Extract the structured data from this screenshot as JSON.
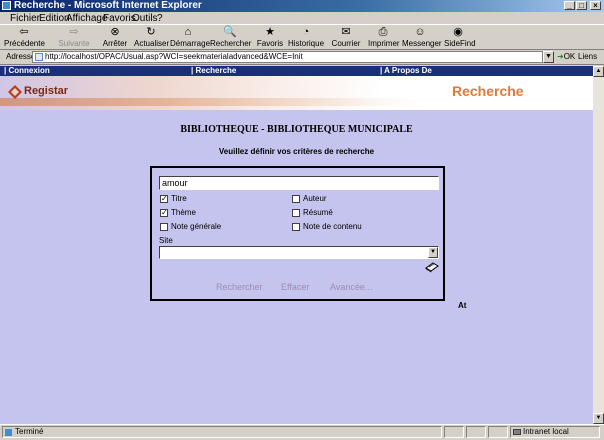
{
  "window": {
    "title": "Recherche - Microsoft Internet Explorer"
  },
  "menu": [
    "Fichier",
    "Edition",
    "Affichage",
    "Favoris",
    "Outils",
    "?"
  ],
  "toolbar": [
    {
      "label": "Précédente",
      "icon": "back-arrow-icon",
      "glyph": "⇦",
      "enabled": true
    },
    {
      "label": "Suivante",
      "icon": "forward-arrow-icon",
      "glyph": "⇨",
      "enabled": false
    },
    {
      "label": "Arrêter",
      "icon": "stop-icon",
      "glyph": "⊗",
      "enabled": true
    },
    {
      "label": "Actualiser",
      "icon": "refresh-icon",
      "glyph": "↻",
      "enabled": true
    },
    {
      "label": "Démarrage",
      "icon": "home-icon",
      "glyph": "⌂",
      "enabled": true
    },
    {
      "label": "Rechercher",
      "icon": "search-icon",
      "glyph": "🔍",
      "enabled": true
    },
    {
      "label": "Favoris",
      "icon": "favorites-icon",
      "glyph": "★",
      "enabled": true
    },
    {
      "label": "Historique",
      "icon": "history-icon",
      "glyph": "◔",
      "enabled": true
    },
    {
      "label": "Courrier",
      "icon": "mail-icon",
      "glyph": "✉",
      "enabled": true
    },
    {
      "label": "Imprimer",
      "icon": "print-icon",
      "glyph": "⎙",
      "enabled": true
    },
    {
      "label": "Messenger",
      "icon": "messenger-icon",
      "glyph": "☺",
      "enabled": true
    },
    {
      "label": "SideFind",
      "icon": "sidefind-icon",
      "glyph": "◉",
      "enabled": true
    }
  ],
  "address": {
    "label": "Adresse",
    "url": "http://localhost/OPAC/Usual.asp?WCI=seekmaterialadvanced&WCE=Init",
    "go": "OK",
    "links": "Liens"
  },
  "nav": [
    "Connexion",
    "Recherche",
    "A Propos De"
  ],
  "banner": {
    "logo": "Registar",
    "title": "Recherche"
  },
  "page": {
    "title": "BIBLIOTHEQUE - BIBLIOTHEQUE MUNICIPALE",
    "subtitle": "Veuillez définir vos critères de recherche"
  },
  "form": {
    "query": "amour",
    "criteria": [
      {
        "label": "Titre",
        "checked": true
      },
      {
        "label": "Auteur",
        "checked": false
      },
      {
        "label": "Thème",
        "checked": true
      },
      {
        "label": "Résumé",
        "checked": false
      },
      {
        "label": "Note générale",
        "checked": false
      },
      {
        "label": "Note de contenu",
        "checked": false
      }
    ],
    "site_label": "Site",
    "site_value": "",
    "actions": [
      "Rechercher",
      "Effacer",
      "Avancée..."
    ]
  },
  "side_text": "At",
  "status": {
    "left": "Terminé",
    "zone": "Intranet local"
  },
  "colors": {
    "page_bg": "#c4c4ee",
    "nav_band": "#1a2f7a",
    "banner_title": "#e07a3a",
    "action_text": "#9c8cb4"
  }
}
